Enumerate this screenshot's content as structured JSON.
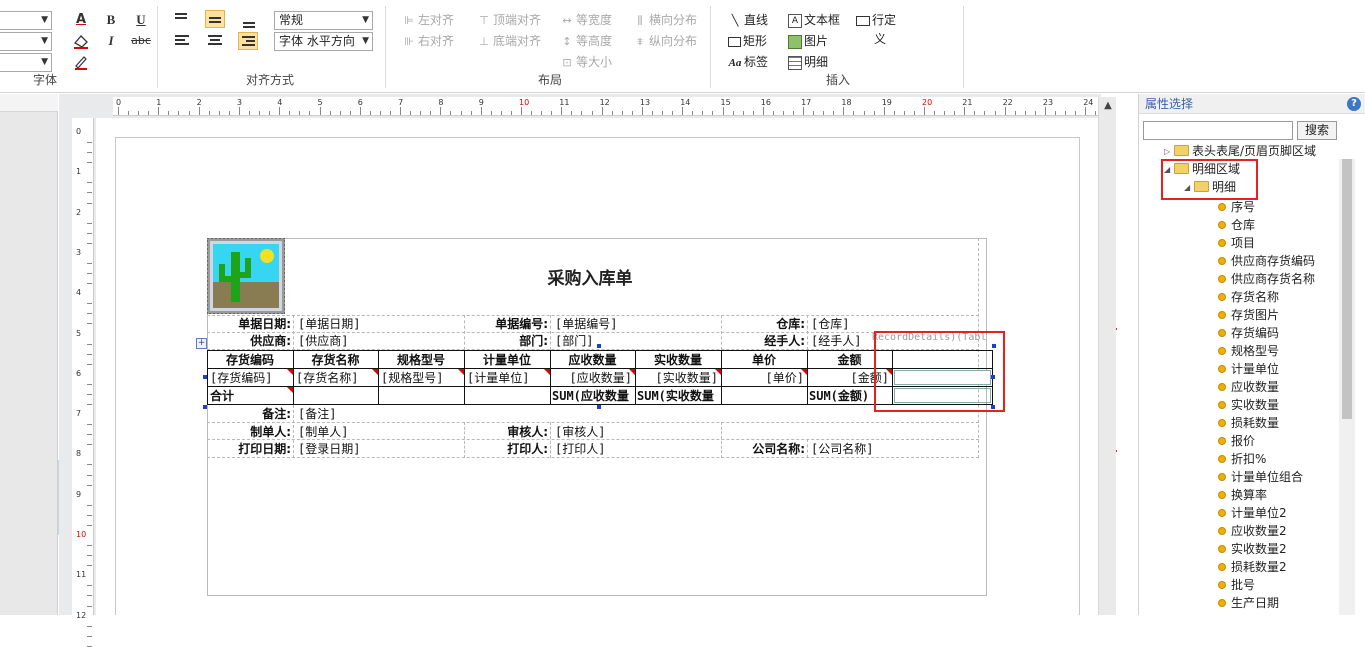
{
  "ribbon": {
    "font_group": {
      "title": "字体",
      "bold": "B",
      "italic": "I",
      "underline": "U",
      "strike": "abc",
      "font_color": "A"
    },
    "align_group": {
      "title": "对齐方式",
      "wrap_select": "常规",
      "direction_select": "字体 水平方向"
    },
    "layout_group": {
      "title": "布局",
      "items": [
        "左对齐",
        "右对齐",
        "顶端对齐",
        "底端对齐",
        "等宽度",
        "等高度",
        "等大小",
        "横向分布",
        "纵向分布"
      ]
    },
    "insert_group": {
      "title": "插入",
      "line": "直线",
      "rect": "矩形",
      "label": "标签",
      "textbox": "文本框",
      "image": "图片",
      "detail": "明细",
      "custom_row_1": "行定",
      "custom_row_2": "义"
    }
  },
  "ruler": {
    "h_ticks": [
      "0",
      "1",
      "2",
      "3",
      "4",
      "5",
      "6",
      "7",
      "8",
      "9",
      "10",
      "11",
      "12",
      "13",
      "14",
      "15",
      "16",
      "17",
      "18",
      "19",
      "20",
      "21",
      "22",
      "23",
      "24"
    ],
    "v_ticks": [
      "0",
      "1",
      "2",
      "3",
      "4",
      "5",
      "6",
      "7",
      "8",
      "9",
      "10",
      "11",
      "12"
    ]
  },
  "report": {
    "title": "采购入库单",
    "row1": {
      "label1": "单据日期:",
      "val1": "[单据日期]",
      "label2": "单据编号:",
      "val2": "[单据编号]",
      "label3": "仓库:",
      "val3": "[仓库]"
    },
    "row2": {
      "label1": "供应商:",
      "val1": "[供应商]",
      "label2": "部门:",
      "val2": "[部门]",
      "label3": "经手人:",
      "val3": "[经手人]",
      "ghost": "RecordDetails)(Tabl"
    },
    "table_headers": [
      "存货编码",
      "存货名称",
      "规格型号",
      "计量单位",
      "应收数量",
      "实收数量",
      "单价",
      "金额"
    ],
    "table_row": [
      "[存货编码]",
      "[存货名称]",
      "[规格型号]",
      "[计量单位]",
      "[应收数量]",
      "[实收数量]",
      "[单价]",
      "[金额]"
    ],
    "total_row": {
      "label": "合计",
      "c5": "SUM(应收数量",
      "c6": "SUM(实收数量",
      "c8": "SUM(金额)"
    },
    "remark": {
      "label": "备注:",
      "val": "[备注]"
    },
    "row_sign": {
      "label1": "制单人:",
      "val1": "[制单人]",
      "label2": "审核人:",
      "val2": "[审核人]"
    },
    "row_print": {
      "label1": "打印日期:",
      "val1": "[登录日期]",
      "label2": "打印人:",
      "val2": "[打印人]",
      "label3": "公司名称:",
      "val3": "[公司名称]"
    }
  },
  "props": {
    "title": "属性选择",
    "search_placeholder": "",
    "search_button": "搜索",
    "tree": {
      "node1": "表头表尾/页眉页脚区域",
      "node2": "明细区域",
      "node3": "明细"
    },
    "leaves": [
      "序号",
      "仓库",
      "项目",
      "供应商存货编码",
      "供应商存货名称",
      "存货名称",
      "存货图片",
      "存货编码",
      "规格型号",
      "计量单位",
      "应收数量",
      "实收数量",
      "损耗数量",
      "报价",
      "折扣%",
      "计量单位组合",
      "换算率",
      "计量单位2",
      "应收数量2",
      "实收数量2",
      "损耗数量2",
      "批号",
      "生产日期"
    ]
  },
  "colors": {
    "highlight_red": "#e52222",
    "folder_yellow": "#f2d16b",
    "leaf_dot": "#f0b000",
    "title_blue": "#3a62a8"
  }
}
